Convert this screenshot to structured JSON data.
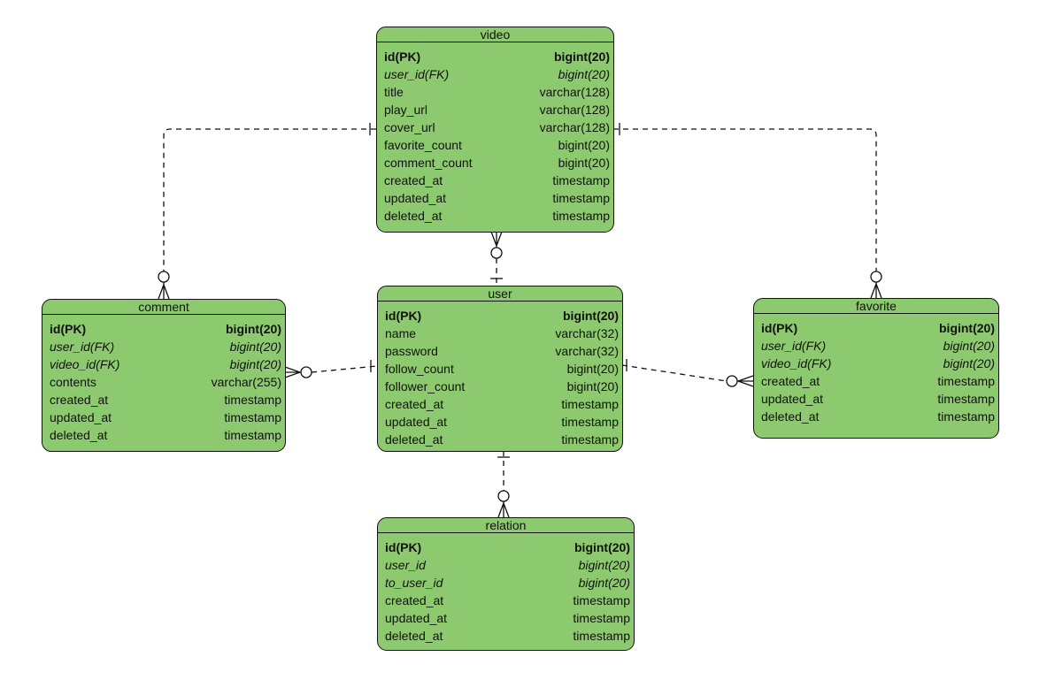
{
  "fill_color": "#8dc96e",
  "tables": [
    {
      "id": "video",
      "name": "video",
      "columns": [
        {
          "name": "id(PK)",
          "type": "bigint(20)",
          "kind": "pk"
        },
        {
          "name": "user_id(FK)",
          "type": "bigint(20)",
          "kind": "fk"
        },
        {
          "name": "title",
          "type": "varchar(128)",
          "kind": ""
        },
        {
          "name": "play_url",
          "type": "varchar(128)",
          "kind": ""
        },
        {
          "name": "cover_url",
          "type": "varchar(128)",
          "kind": ""
        },
        {
          "name": "favorite_count",
          "type": "bigint(20)",
          "kind": ""
        },
        {
          "name": "comment_count",
          "type": "bigint(20)",
          "kind": ""
        },
        {
          "name": "created_at",
          "type": "timestamp",
          "kind": ""
        },
        {
          "name": "updated_at",
          "type": "timestamp",
          "kind": ""
        },
        {
          "name": "deleted_at",
          "type": "timestamp",
          "kind": ""
        }
      ]
    },
    {
      "id": "user",
      "name": "user",
      "columns": [
        {
          "name": "id(PK)",
          "type": "bigint(20)",
          "kind": "pk"
        },
        {
          "name": "name",
          "type": "varchar(32)",
          "kind": ""
        },
        {
          "name": "password",
          "type": "varchar(32)",
          "kind": ""
        },
        {
          "name": "follow_count",
          "type": "bigint(20)",
          "kind": ""
        },
        {
          "name": "follower_count",
          "type": "bigint(20)",
          "kind": ""
        },
        {
          "name": "created_at",
          "type": "timestamp",
          "kind": ""
        },
        {
          "name": "updated_at",
          "type": "timestamp",
          "kind": ""
        },
        {
          "name": "deleted_at",
          "type": "timestamp",
          "kind": ""
        }
      ]
    },
    {
      "id": "comment",
      "name": "comment",
      "columns": [
        {
          "name": "id(PK)",
          "type": "bigint(20)",
          "kind": "pk"
        },
        {
          "name": "user_id(FK)",
          "type": "bigint(20)",
          "kind": "fk"
        },
        {
          "name": "video_id(FK)",
          "type": "bigint(20)",
          "kind": "fk"
        },
        {
          "name": "contents",
          "type": "varchar(255)",
          "kind": ""
        },
        {
          "name": "created_at",
          "type": "timestamp",
          "kind": ""
        },
        {
          "name": "updated_at",
          "type": "timestamp",
          "kind": ""
        },
        {
          "name": "deleted_at",
          "type": "timestamp",
          "kind": ""
        }
      ]
    },
    {
      "id": "favorite",
      "name": "favorite",
      "columns": [
        {
          "name": "id(PK)",
          "type": "bigint(20)",
          "kind": "pk"
        },
        {
          "name": "user_id(FK)",
          "type": "bigint(20)",
          "kind": "fk"
        },
        {
          "name": "video_id(FK)",
          "type": "bigint(20)",
          "kind": "fk"
        },
        {
          "name": "created_at",
          "type": "timestamp",
          "kind": ""
        },
        {
          "name": "updated_at",
          "type": "timestamp",
          "kind": ""
        },
        {
          "name": "deleted_at",
          "type": "timestamp",
          "kind": ""
        }
      ]
    },
    {
      "id": "relation",
      "name": "relation",
      "columns": [
        {
          "name": "id(PK)",
          "type": "bigint(20)",
          "kind": "pk"
        },
        {
          "name": "user_id",
          "type": "bigint(20)",
          "kind": "fk"
        },
        {
          "name": "to_user_id",
          "type": "bigint(20)",
          "kind": "fk"
        },
        {
          "name": "created_at",
          "type": "timestamp",
          "kind": ""
        },
        {
          "name": "updated_at",
          "type": "timestamp",
          "kind": ""
        },
        {
          "name": "deleted_at",
          "type": "timestamp",
          "kind": ""
        }
      ]
    }
  ],
  "relationships": [
    {
      "from": "video",
      "to": "comment",
      "cardinality": "one-to-zero-or-many"
    },
    {
      "from": "video",
      "to": "favorite",
      "cardinality": "one-to-zero-or-many"
    },
    {
      "from": "user",
      "to": "video",
      "cardinality": "one-to-zero-or-many"
    },
    {
      "from": "user",
      "to": "comment",
      "cardinality": "one-to-zero-or-many"
    },
    {
      "from": "user",
      "to": "favorite",
      "cardinality": "one-to-zero-or-many"
    },
    {
      "from": "user",
      "to": "relation",
      "cardinality": "one-to-zero-or-many"
    }
  ]
}
